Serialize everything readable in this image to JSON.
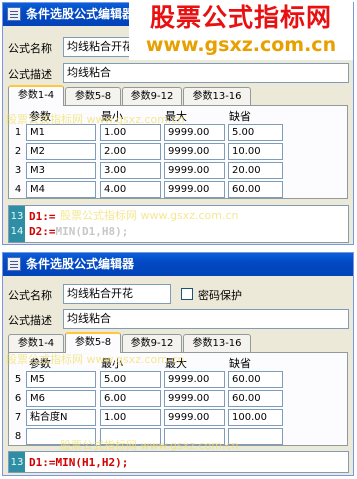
{
  "banner": {
    "title": "股票公式指标网",
    "url": "www.gsxz.com.cn"
  },
  "dialog1": {
    "title": "条件选股公式编辑器",
    "name_label": "公式名称",
    "name_value": "均线粘合开花",
    "desc_label": "公式描述",
    "desc_value": "均线粘合",
    "tabs": [
      "参数1-4",
      "参数5-8",
      "参数9-12",
      "参数13-16"
    ],
    "active_tab": 0,
    "headers": [
      "参数",
      "最小",
      "最大",
      "缺省"
    ],
    "rows": [
      {
        "num": "1",
        "name": "M1",
        "min": "1.00",
        "max": "9999.00",
        "def": "5.00"
      },
      {
        "num": "2",
        "name": "M2",
        "min": "2.00",
        "max": "9999.00",
        "def": "10.00"
      },
      {
        "num": "3",
        "name": "M3",
        "min": "3.00",
        "max": "9999.00",
        "def": "20.00"
      },
      {
        "num": "4",
        "name": "M4",
        "min": "4.00",
        "max": "9999.00",
        "def": "60.00"
      }
    ],
    "code": [
      {
        "ln": "13",
        "kw": "D1:=",
        "rest": ""
      },
      {
        "ln": "14",
        "kw": "D2:=",
        "rest": "MIN(D1,H8);"
      }
    ]
  },
  "dialog2": {
    "title": "条件选股公式编辑器",
    "name_label": "公式名称",
    "name_value": "均线粘合开花",
    "password_label": "密码保护",
    "desc_label": "公式描述",
    "desc_value": "均线粘合",
    "tabs": [
      "参数1-4",
      "参数5-8",
      "参数9-12",
      "参数13-16"
    ],
    "active_tab": 1,
    "headers": [
      "参数",
      "最小",
      "最大",
      "缺省"
    ],
    "rows": [
      {
        "num": "5",
        "name": "M5",
        "min": "5.00",
        "max": "9999.00",
        "def": "60.00"
      },
      {
        "num": "6",
        "name": "M6",
        "min": "6.00",
        "max": "9999.00",
        "def": "60.00"
      },
      {
        "num": "7",
        "name": "粘合度N",
        "min": "1.00",
        "max": "9999.00",
        "def": "100.00"
      },
      {
        "num": "8",
        "name": "",
        "min": "",
        "max": "",
        "def": ""
      }
    ],
    "code": [
      {
        "ln": "13",
        "kw": "D1:=",
        "rest": "MIN(H1,H2);"
      }
    ]
  },
  "watermark": "股票公式指标网 www.gsxz.com.cn"
}
